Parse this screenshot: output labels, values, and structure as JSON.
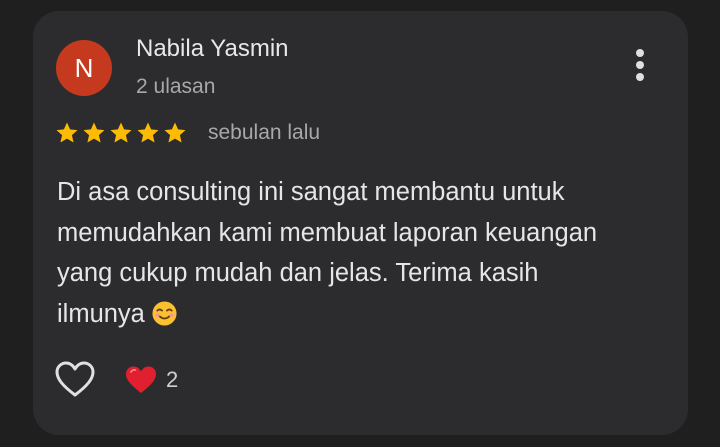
{
  "review": {
    "author_initial": "N",
    "author_name": "Nabila Yasmin",
    "author_review_count": "2 ulasan",
    "rating": 5,
    "rating_max": 5,
    "time_ago": "sebulan lalu",
    "text_lines": [
      "Di asa consulting ini sangat membantu untuk",
      "memudahkan kami membuat laporan keuangan",
      "yang cukup mudah dan jelas. Terima kasih",
      "ilmunya"
    ],
    "text_emoji": "smiling-face-emoji",
    "reaction_count": "2"
  },
  "icons": {
    "more": "more-vertical-icon",
    "like": "heart-outline-icon",
    "reaction": "red-heart-icon",
    "star": "star-icon"
  },
  "colors": {
    "background": "#1f1f1f",
    "card": "#2c2c2e",
    "avatar": "#c5391f",
    "star": "#fcbc05",
    "reaction_heart": "#e0202f"
  }
}
